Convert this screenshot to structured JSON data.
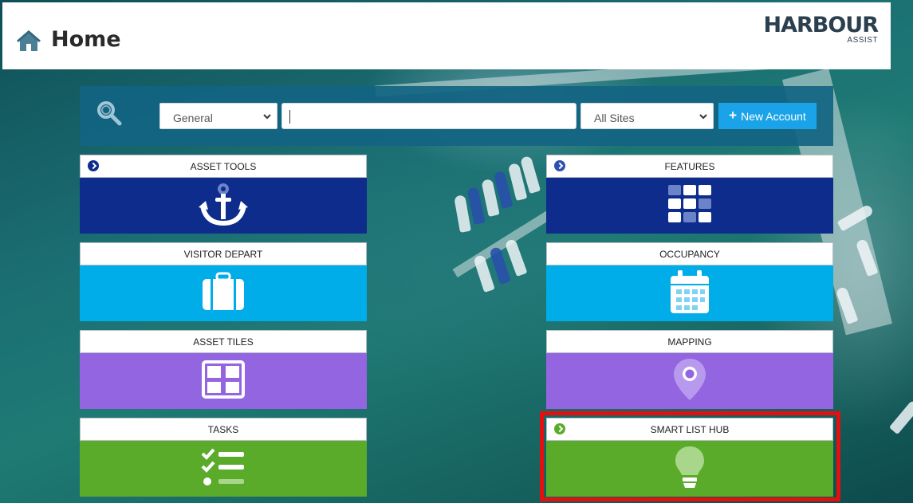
{
  "header": {
    "title": "Home",
    "home_icon": "home-icon",
    "logo_text": "HARBOUR",
    "logo_sub": "ASSIST"
  },
  "search": {
    "icon": "search-icon",
    "type_select": "General",
    "query_value": "",
    "site_select": "All Sites",
    "new_account_label": "New Account"
  },
  "tiles": [
    {
      "label": "ASSET TOOLS",
      "icon": "anchor-icon",
      "color": "#0e2c8b",
      "has_arrow": true
    },
    {
      "label": "FEATURES",
      "icon": "grid-icon",
      "color": "#0e2c8b",
      "has_arrow": true
    },
    {
      "label": "VISITOR DEPART",
      "icon": "suitcase-icon",
      "color": "#00ade8",
      "has_arrow": false
    },
    {
      "label": "OCCUPANCY",
      "icon": "calendar-icon",
      "color": "#00ade8",
      "has_arrow": false
    },
    {
      "label": "ASSET TILES",
      "icon": "layout-icon",
      "color": "#9365e0",
      "has_arrow": false
    },
    {
      "label": "MAPPING",
      "icon": "map-pin-icon",
      "color": "#9365e0",
      "has_arrow": false
    },
    {
      "label": "TASKS",
      "icon": "checklist-icon",
      "color": "#5aab2a",
      "has_arrow": false
    },
    {
      "label": "SMART LIST HUB",
      "icon": "lightbulb-icon",
      "color": "#5aab2a",
      "has_arrow": true
    }
  ],
  "colors": {
    "header_icon": "#4a7f95",
    "search_bar": "#12648c",
    "button": "#1aa3e8",
    "highlight": "#e60f0f"
  }
}
